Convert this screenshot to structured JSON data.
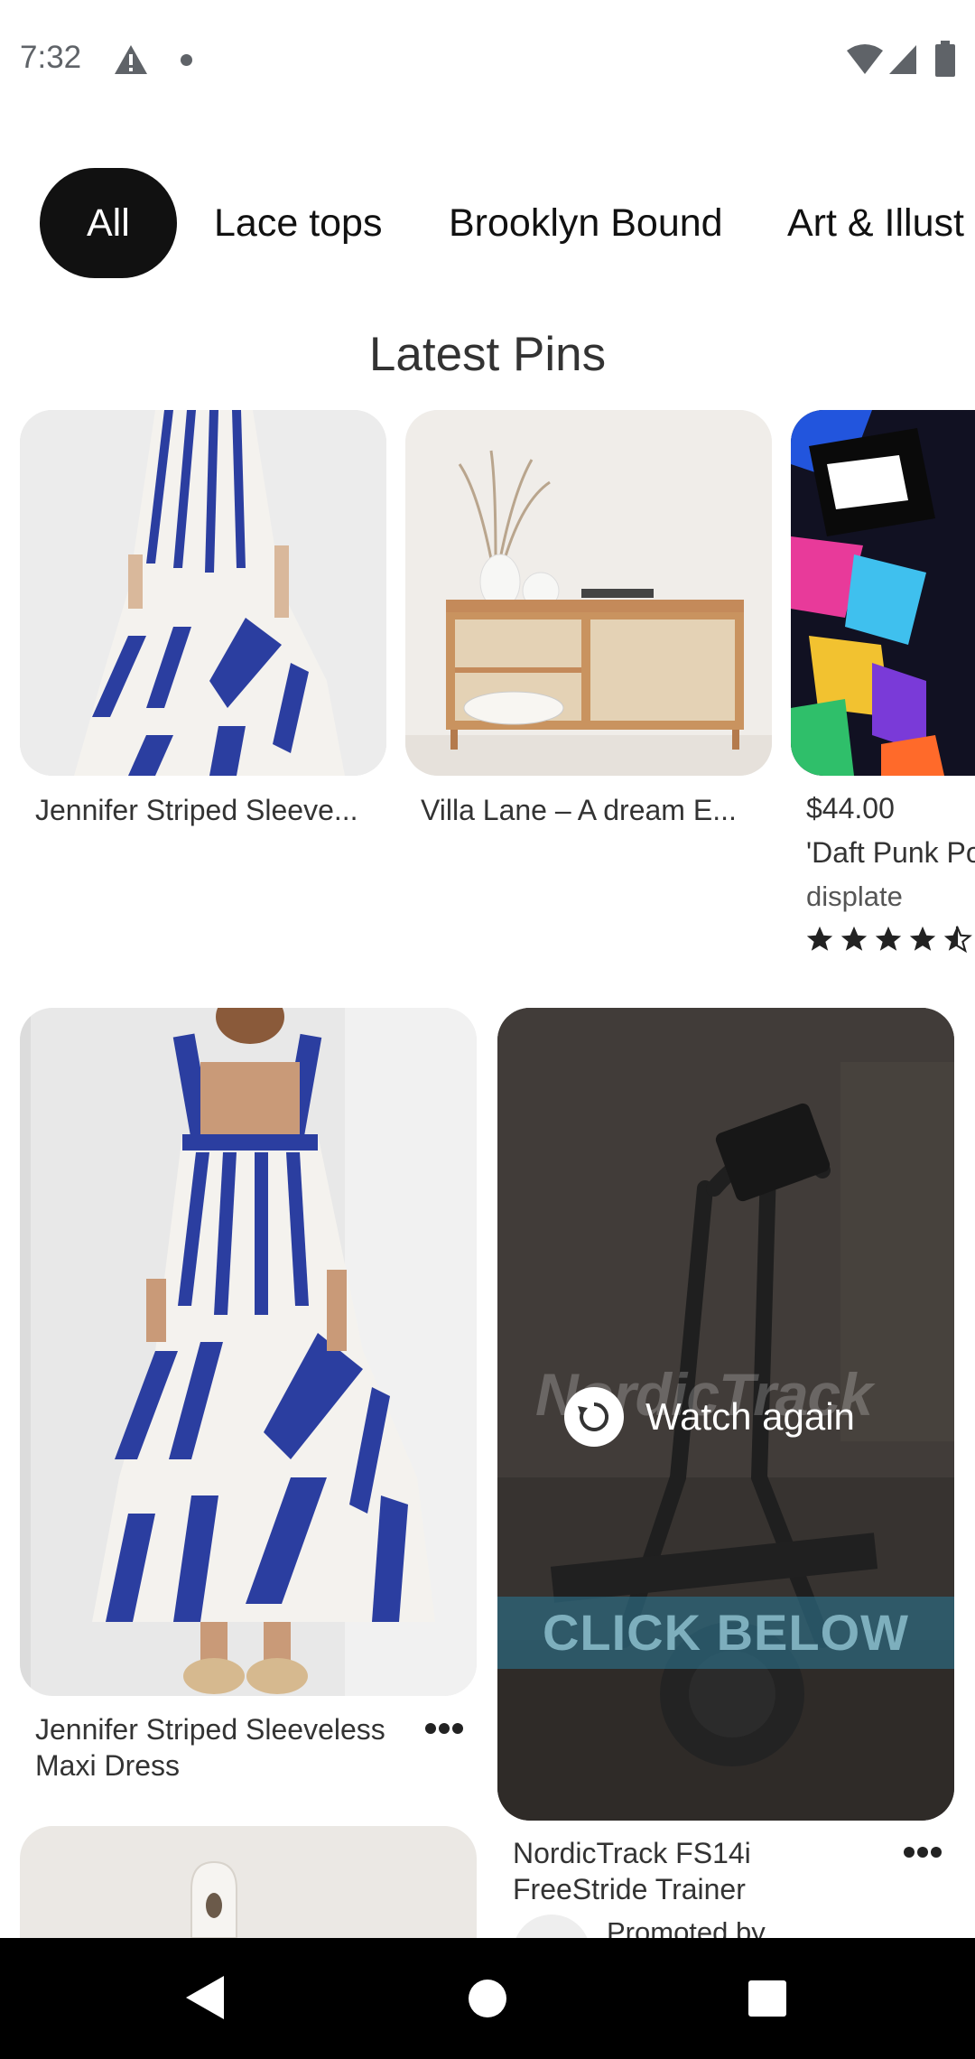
{
  "status_bar": {
    "time": "7:32",
    "icons": [
      "warning-icon",
      "notification-dot-icon",
      "wifi-icon",
      "signal-icon",
      "battery-icon"
    ]
  },
  "tabs": [
    {
      "label": "All",
      "active": true
    },
    {
      "label": "Lace tops",
      "active": false
    },
    {
      "label": "Brooklyn Bound",
      "active": false
    },
    {
      "label": "Art & Illust",
      "active": false
    }
  ],
  "latest_pins": {
    "title": "Latest Pins",
    "items": [
      {
        "title": "Jennifer Striped Sleeve..."
      },
      {
        "title": "Villa Lane – A dream E..."
      },
      {
        "price": "$44.00",
        "title": "'Daft Punk Po",
        "merchant": "displate",
        "rating": 4.5
      }
    ]
  },
  "feed": {
    "left_pin": {
      "title_line1": "Jennifer Striped Sleeveless",
      "title_line2": "Maxi Dress"
    },
    "right_pin": {
      "overlay_action": "Watch again",
      "brand_text": "NordicTrack",
      "banner": "CLICK BELOW",
      "title_line1": "NordicTrack FS14i",
      "title_line2": "FreeStride Trainer",
      "promoted": "Promoted by"
    }
  },
  "colors": {
    "active_tab_bg": "#111111",
    "dress_blue": "#2b3ea0",
    "nav_bar": "#000000"
  }
}
